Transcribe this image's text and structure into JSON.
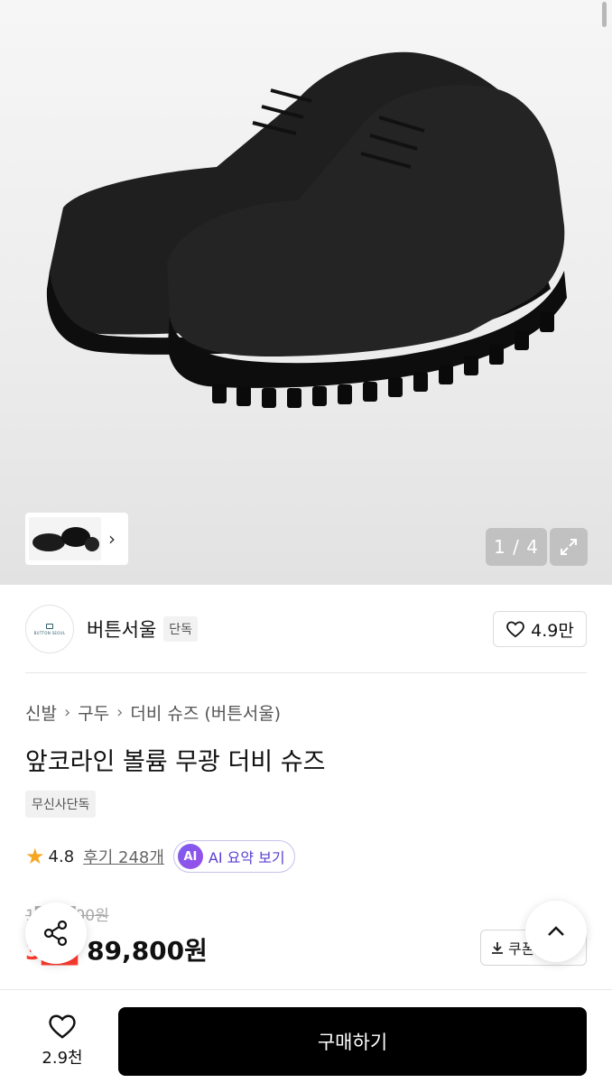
{
  "gallery": {
    "counter": "1 / 4",
    "icons": {
      "thumb_next": "chevron-right-icon",
      "expand": "expand-icon"
    }
  },
  "brand": {
    "logo_text": "BUTTON SEOUL",
    "name": "버튼서울",
    "tag": "단독",
    "like_count": "4.9만"
  },
  "breadcrumb": [
    "신발",
    "구두",
    "더비 슈즈 (버튼서울)"
  ],
  "product": {
    "title": "앞코라인 볼륨 무광 더비 슈즈",
    "badge": "무신사단독",
    "rating": "4.8",
    "reviews_label": "후기 248개",
    "ai_label": "AI",
    "ai_summary_label": "AI 요약 보기"
  },
  "price": {
    "original": "1██,█00원",
    "discount": "3██",
    "current": "89,800원",
    "coupon_label": "쿠폰"
  },
  "bottom": {
    "wish_count": "2.9천",
    "buy_label": "구매하기"
  },
  "colors": {
    "accent_star": "#f5a623",
    "discount_red": "#ff3b30",
    "ai_purple": "#7b5cf0"
  }
}
